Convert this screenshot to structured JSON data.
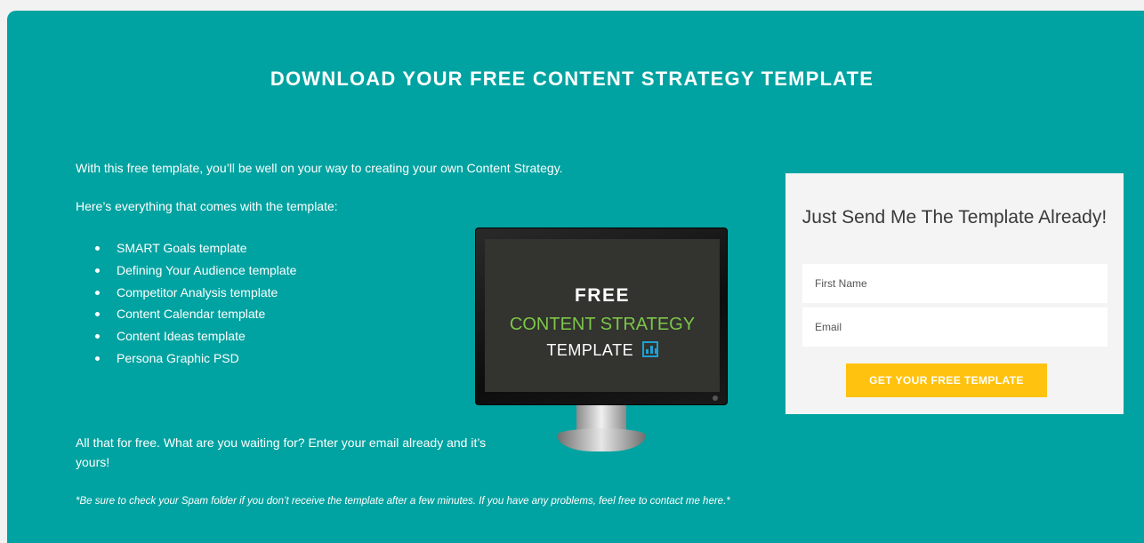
{
  "headline": "DOWNLOAD YOUR FREE CONTENT STRATEGY TEMPLATE",
  "intro": "With this free template, you’ll be well on your way to creating your own Content Strategy.",
  "features_heading": "Here’s everything that comes with the template:",
  "features": [
    "SMART Goals template",
    "Defining Your Audience template",
    "Competitor Analysis template",
    "Content Calendar template",
    "Content Ideas template",
    "Persona Graphic PSD"
  ],
  "closing": "All that for free. What are you waiting for? Enter your email already and it’s yours!",
  "note": "*Be sure to check your Spam folder if you don’t receive the template after a few minutes. If you have any problems, feel free to contact me here.*",
  "monitor": {
    "line1": "FREE",
    "line2": "CONTENT STRATEGY",
    "line3": "TEMPLATE",
    "icon": "bar-chart-icon"
  },
  "form": {
    "title": "Just Send Me The Template Already!",
    "first_name_placeholder": "First Name",
    "email_placeholder": "Email",
    "submit_label": "GET YOUR FREE TEMPLATE"
  },
  "colors": {
    "background": "#00a3a1",
    "button": "#ffc20e",
    "screen_green": "#7cc64a",
    "icon_blue": "#1da1d6"
  }
}
